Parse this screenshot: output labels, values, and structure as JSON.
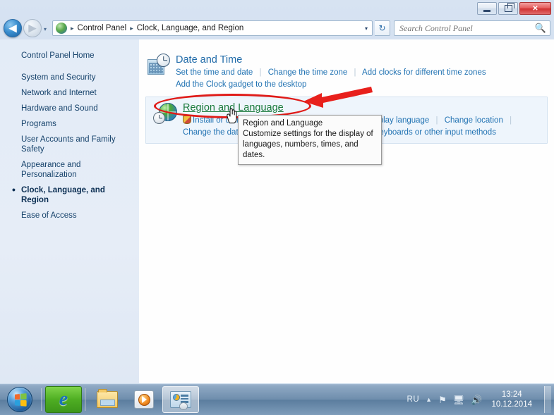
{
  "window": {
    "buttons": {
      "minimize": "minimize",
      "maximize": "restore",
      "close": "✕"
    }
  },
  "navbar": {
    "back_tooltip": "Back",
    "forward_tooltip": "Forward",
    "recent_pages": "▾",
    "breadcrumb": [
      "Control Panel",
      "Clock, Language, and Region"
    ],
    "breadcrumb_separator": "▸",
    "address_dropdown": "▾",
    "refresh": "↻",
    "search_placeholder": "Search Control Panel",
    "search_value": ""
  },
  "sidebar": {
    "home": "Control Panel Home",
    "items": [
      {
        "label": "System and Security",
        "current": false
      },
      {
        "label": "Network and Internet",
        "current": false
      },
      {
        "label": "Hardware and Sound",
        "current": false
      },
      {
        "label": "Programs",
        "current": false
      },
      {
        "label": "User Accounts and Family Safety",
        "current": false
      },
      {
        "label": "Appearance and Personalization",
        "current": false
      },
      {
        "label": "Clock, Language, and Region",
        "current": true
      },
      {
        "label": "Ease of Access",
        "current": false
      }
    ]
  },
  "main": {
    "categories": [
      {
        "title": "Date and Time",
        "icon": "clock-calendar-icon",
        "row1": [
          "Set the time and date",
          "Change the time zone",
          "Add clocks for different time zones"
        ],
        "row2": [
          "Add the Clock gadget to the desktop"
        ]
      },
      {
        "title": "Region and Language",
        "icon": "globe-clock-icon",
        "row1": [
          "Install or uninstall display languages",
          "Change display language",
          "Change location"
        ],
        "row2": [
          "Change the date, time, or number format",
          "Change keyboards or other input methods"
        ]
      }
    ]
  },
  "tooltip": {
    "title": "Region and Language",
    "body": "Customize settings for the display of languages, numbers, times, and dates."
  },
  "annotations": {
    "oval_color": "#e01b18",
    "arrow_color": "#e8201c"
  },
  "taskbar": {
    "start": "Start",
    "items": [
      {
        "name": "internet-explorer",
        "label": "Internet Explorer",
        "active": true
      },
      {
        "name": "windows-explorer",
        "label": "Windows Explorer",
        "active": false
      },
      {
        "name": "windows-media-player",
        "label": "Windows Media Player",
        "active": false
      },
      {
        "name": "control-panel",
        "label": "Control Panel",
        "active": true
      }
    ],
    "tray": {
      "language": "RU",
      "show_hidden": "▲",
      "icons": [
        "flag-icon",
        "network-icon",
        "volume-icon"
      ],
      "time": "13:24",
      "date": "10.12.2014"
    }
  }
}
